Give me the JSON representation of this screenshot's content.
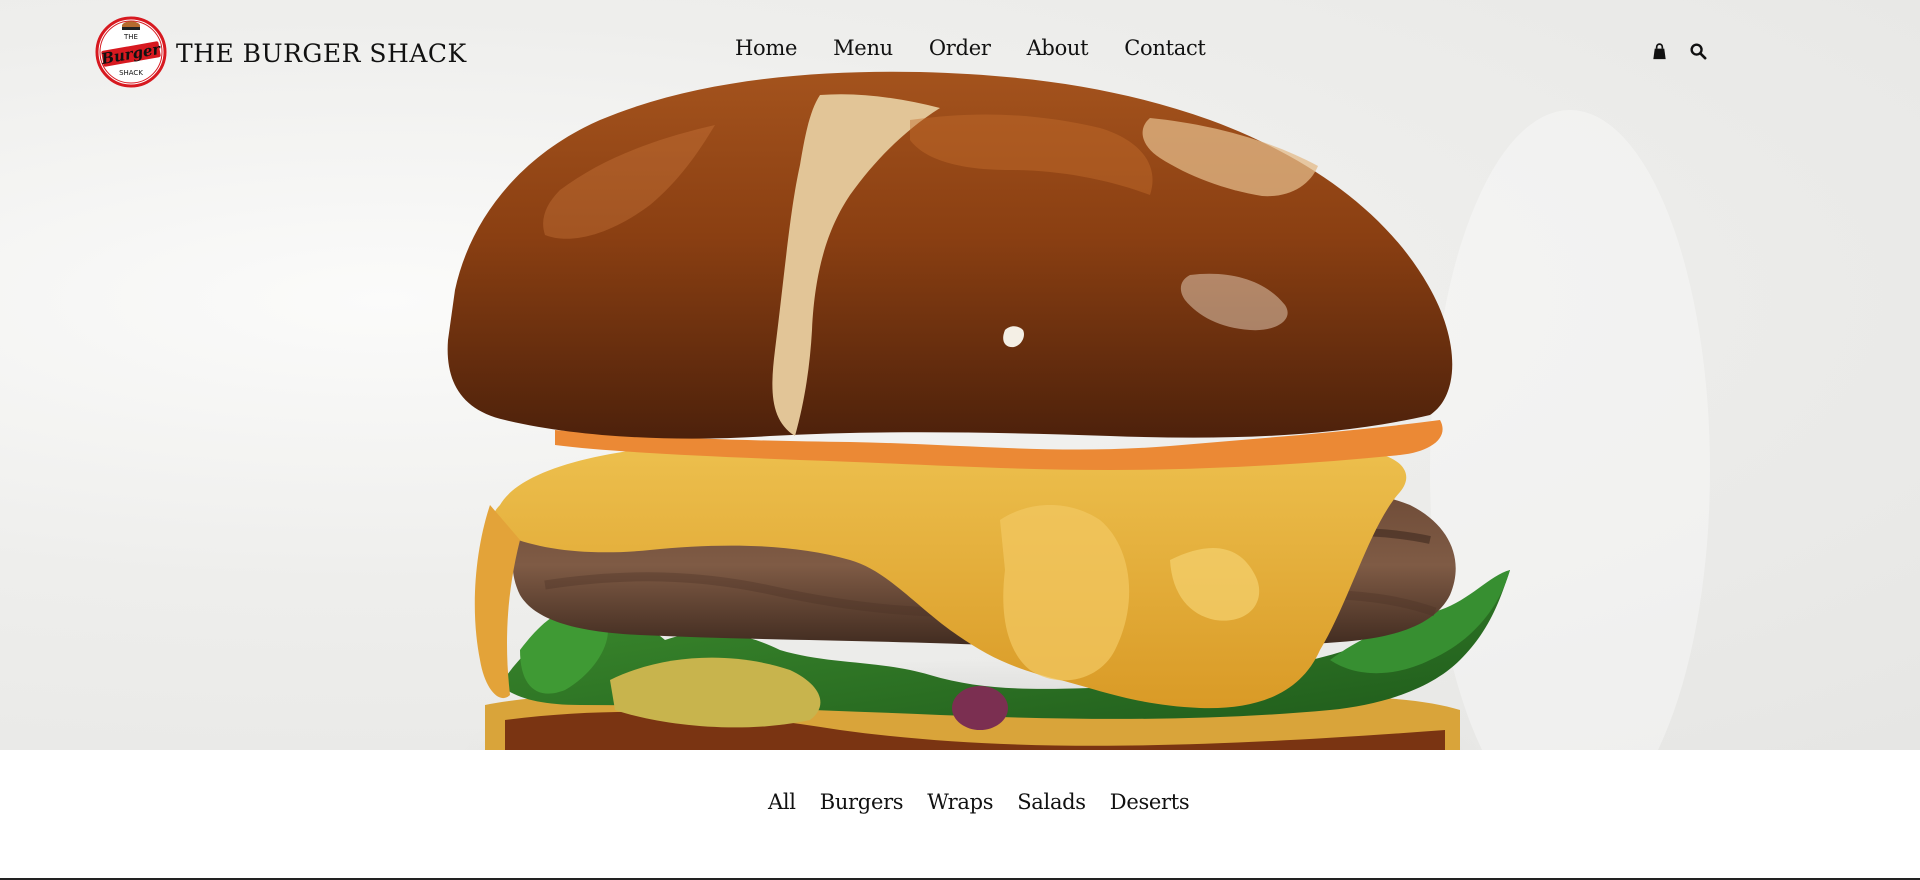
{
  "brand": {
    "name": "THE BURGER SHACK",
    "logo_text": {
      "top": "THE",
      "middle": "Burger",
      "bottom": "SHACK"
    }
  },
  "nav": {
    "items": [
      {
        "label": "Home"
      },
      {
        "label": "Menu"
      },
      {
        "label": "Order"
      },
      {
        "label": "About"
      },
      {
        "label": "Contact"
      }
    ],
    "icons": [
      "shopping-bag-icon",
      "search-icon"
    ]
  },
  "filters": {
    "items": [
      {
        "label": "All"
      },
      {
        "label": "Burgers"
      },
      {
        "label": "Wraps"
      },
      {
        "label": "Salads"
      },
      {
        "label": "Deserts"
      }
    ]
  },
  "colors": {
    "logo_red": "#d71920",
    "text": "#111111",
    "hero_background": "#efefee",
    "bun": "#8a3f12",
    "cheese": "#e7ae35"
  }
}
